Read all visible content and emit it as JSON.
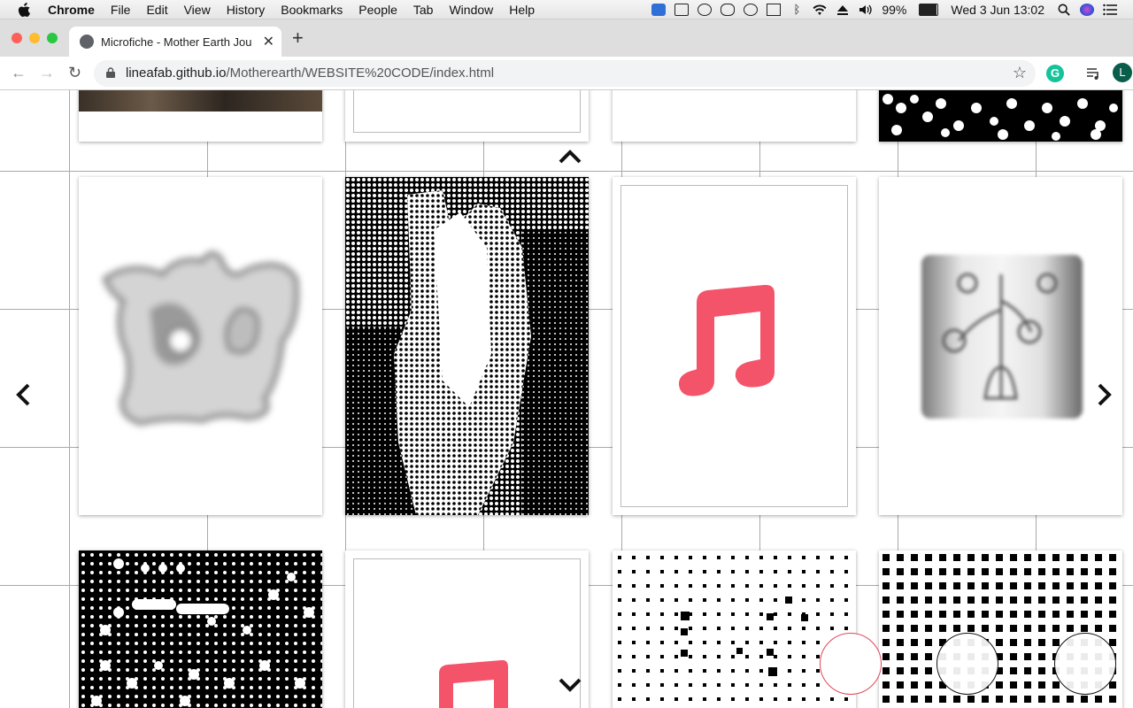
{
  "menubar": {
    "app_name": "Chrome",
    "items": [
      "File",
      "Edit",
      "View",
      "History",
      "Bookmarks",
      "People",
      "Tab",
      "Window",
      "Help"
    ],
    "battery": "99%",
    "datetime": "Wed 3 Jun  13:02"
  },
  "tab": {
    "title": "Microfiche - Mother Earth Jour",
    "close_icon": "close-icon"
  },
  "toolbar": {
    "url_host": "lineafab.github.io",
    "url_path": "/Motherearth/WEBSITE%20CODE/index.html",
    "profile_initial": "L",
    "grammarly_initial": "G"
  },
  "page": {
    "up_icon": "chevron-up-icon",
    "down_icon": "chevron-down-icon",
    "left_icon": "chevron-left-icon",
    "right_icon": "chevron-right-icon",
    "music_color": "#f4546a",
    "outline_color": "#e0455a"
  }
}
